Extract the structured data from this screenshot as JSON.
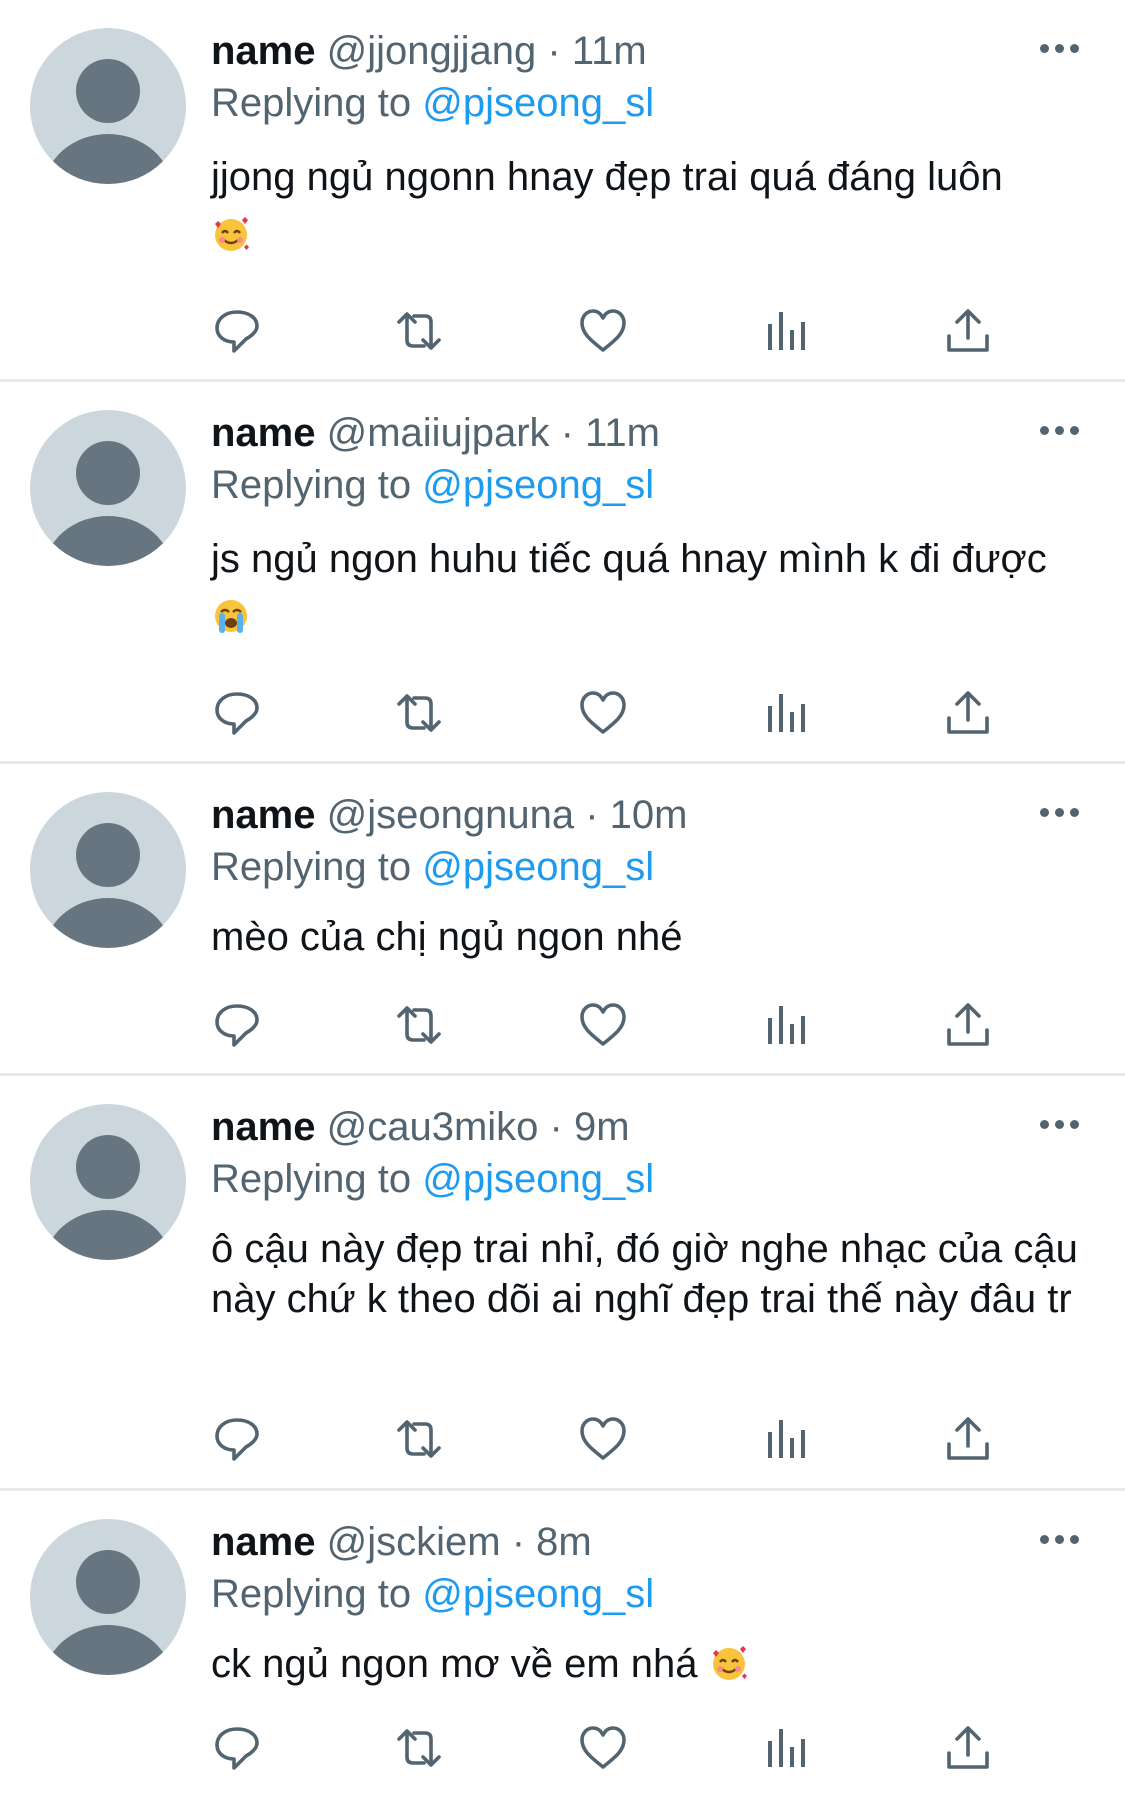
{
  "tweets": [
    {
      "name": "name",
      "handle": "@jjongjjang",
      "separator": "·",
      "time": "11m",
      "replying_label": "Replying to",
      "replying_to": "@pjseong_sl",
      "text": "jjong ngủ ngonn hnay đẹp trai quá đáng luôn",
      "emoji": "smiling-face-with-hearts"
    },
    {
      "name": "name",
      "handle": "@maiiujpark",
      "separator": "·",
      "time": "11m",
      "replying_label": "Replying to",
      "replying_to": "@pjseong_sl",
      "text": "js ngủ ngon huhu tiếc quá hnay mình k đi được",
      "emoji": "loudly-crying-face"
    },
    {
      "name": "name",
      "handle": "@jseongnuna",
      "separator": "·",
      "time": "10m",
      "replying_label": "Replying to",
      "replying_to": "@pjseong_sl",
      "text": "mèo của chị ngủ ngon nhé",
      "emoji": ""
    },
    {
      "name": "name",
      "handle": "@cau3miko",
      "separator": "·",
      "time": "9m",
      "replying_label": "Replying to",
      "replying_to": "@pjseong_sl",
      "text": "ô cậu này đẹp trai nhỉ, đó giờ nghe nhạc của cậu này chứ k theo dõi ai nghĩ đẹp trai thế này đâu tr",
      "emoji": ""
    },
    {
      "name": "name",
      "handle": "@jsckiem",
      "separator": "·",
      "time": "8m",
      "replying_label": "Replying to",
      "replying_to": "@pjseong_sl",
      "text": "ck ngủ ngon mơ về em nhá",
      "emoji": "smiling-face-with-hearts"
    }
  ],
  "icons": {
    "reply": "reply-icon",
    "retweet": "retweet-icon",
    "like": "heart-icon",
    "views": "analytics-icon",
    "share": "share-icon",
    "more": "more-options-icon"
  },
  "colors": {
    "accent": "#1d9bf0",
    "secondary_text": "#536471",
    "primary_text": "#0f1419",
    "avatar_bg": "#ccd6dd",
    "avatar_fg": "#66757f",
    "divider": "#e7e9eb"
  }
}
